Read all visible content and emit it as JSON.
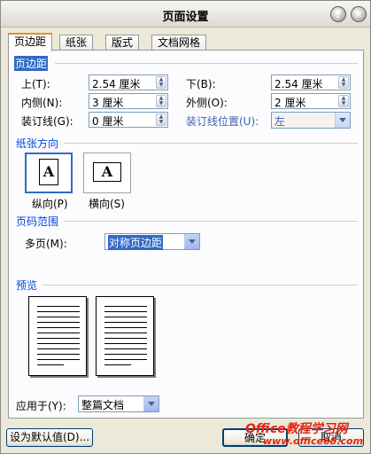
{
  "window": {
    "title": "页面设置",
    "help_glyph": "?",
    "close_glyph": "✕"
  },
  "tabs": [
    {
      "label": "页边距",
      "active": true
    },
    {
      "label": "纸张",
      "active": false
    },
    {
      "label": "版式",
      "active": false
    },
    {
      "label": "文档网格",
      "active": false
    }
  ],
  "margins": {
    "section_title": "页边距",
    "top": {
      "label": "上(T):",
      "value": "2.54 厘米"
    },
    "bottom": {
      "label": "下(B):",
      "value": "2.54 厘米"
    },
    "inside": {
      "label": "内侧(N):",
      "value": "3 厘米"
    },
    "outside": {
      "label": "外侧(O):",
      "value": "2 厘米"
    },
    "gutter": {
      "label": "装订线(G):",
      "value": "0 厘米"
    },
    "gutter_position": {
      "label": "装订线位置(U):",
      "value": "左"
    }
  },
  "orientation": {
    "section_title": "纸张方向",
    "glyph": "A",
    "portrait": {
      "label": "纵向(P)",
      "selected": true
    },
    "landscape": {
      "label": "横向(S)",
      "selected": false
    }
  },
  "pages": {
    "section_title": "页码范围",
    "multiple_label": "多页(M):",
    "multiple_value": "对称页边距"
  },
  "preview": {
    "section_title": "预览"
  },
  "apply_to": {
    "label": "应用于(Y):",
    "value": "整篇文档"
  },
  "buttons": {
    "default": "设为默认值(D)...",
    "ok": "确定",
    "cancel": "取消"
  },
  "watermark": {
    "line1": "Office教程学习网",
    "line2": "www.office68.com"
  },
  "colors": {
    "accent": "#316ac5",
    "group_title": "#0046d5",
    "tab_highlight": "#e68b2c",
    "watermark": "#e8220f"
  }
}
